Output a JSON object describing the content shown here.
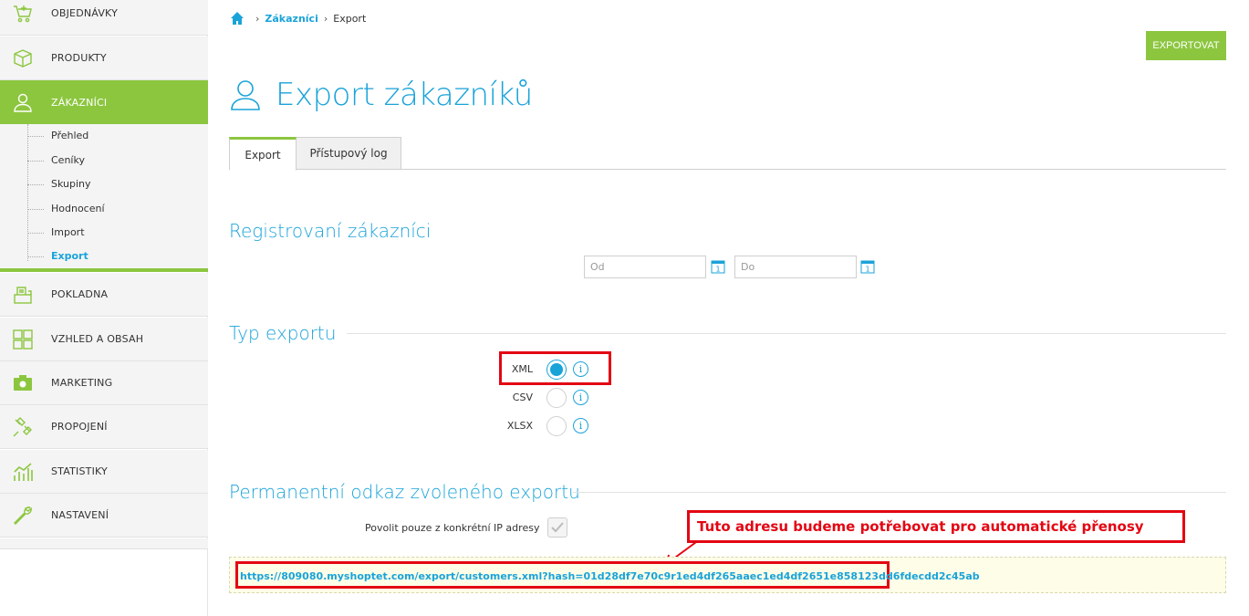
{
  "sidebar": {
    "items": [
      {
        "label": "OBJEDNÁVKY",
        "icon": "cart-icon"
      },
      {
        "label": "PRODUKTY",
        "icon": "box-icon"
      },
      {
        "label": "ZÁKAZNÍCI",
        "icon": "user-icon"
      },
      {
        "label": "POKLADNA",
        "icon": "cash-register-icon"
      },
      {
        "label": "VZHLED A OBSAH",
        "icon": "layout-icon"
      },
      {
        "label": "MARKETING",
        "icon": "megaphone-icon"
      },
      {
        "label": "PROPOJENÍ",
        "icon": "plug-icon"
      },
      {
        "label": "STATISTIKY",
        "icon": "stats-icon"
      },
      {
        "label": "NASTAVENÍ",
        "icon": "wrench-icon"
      }
    ],
    "submenu": [
      "Přehled",
      "Ceníky",
      "Skupiny",
      "Hodnocení",
      "Import",
      "Export"
    ]
  },
  "breadcrumb": {
    "parent": "Zákazníci",
    "current": "Export"
  },
  "header": {
    "export_button": "EXPORTOVAT",
    "title": "Export zákazníků"
  },
  "tabs": [
    "Export",
    "Přístupový log"
  ],
  "registered": {
    "title": "Registrovaní zákazníci",
    "from_placeholder": "Od",
    "to_placeholder": "Do"
  },
  "export_type": {
    "title": "Typ exportu",
    "options": [
      "XML",
      "CSV",
      "XLSX"
    ],
    "selected": "XML"
  },
  "permalink": {
    "title": "Permanentní odkaz zvoleného exportu",
    "ip_label": "Povolit pouze z konkrétní IP adresy",
    "annotation": "Tuto adresu budeme potřebovat pro automatické přenosy",
    "url": "https://809080.myshoptet.com/export/customers.xml?hash=01d28df7e70c9r1ed4df265aaec1ed4df2651e858123dd6fdecdd2c45ab"
  },
  "colors": {
    "accent_green": "#8cc63f",
    "accent_blue": "#1aa3d9",
    "annotation_red": "#e30613"
  }
}
